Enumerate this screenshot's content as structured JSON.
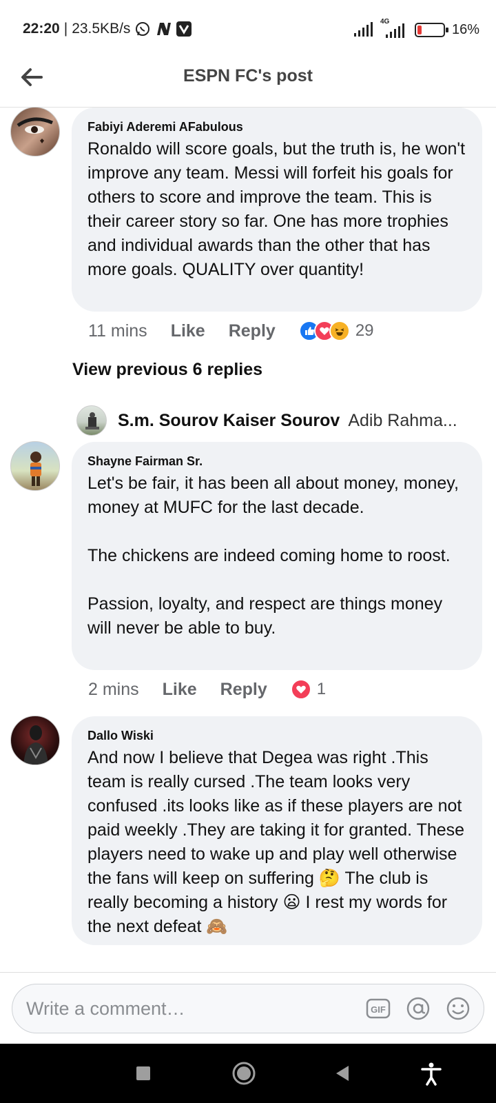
{
  "status_bar": {
    "time": "22:20",
    "speed": "23.5KB/s",
    "network": "4G",
    "battery": "16%",
    "battery_level": 0.16,
    "battery_color": "#e53935"
  },
  "header": {
    "title": "ESPN FC's post",
    "back_icon": "arrow-left-icon"
  },
  "comments": [
    {
      "author": "Fabiyi Aderemi AFabulous",
      "text": "Ronaldo will score goals, but the truth is, he won't improve any team. Messi will forfeit his goals for others to score and improve the team. This is their career story so far. One has more trophies and individual awards than the other that has more goals. QUALITY over quantity!",
      "time": "11 mins",
      "like": "Like",
      "reply": "Reply",
      "reaction_count": "29",
      "reactions": [
        "like",
        "love",
        "haha"
      ]
    },
    {
      "author": "Shayne Fairman Sr.",
      "text": "Let's be fair, it has been all about money, money, money at MUFC for the last decade.\n\nThe chickens are indeed coming home to roost.\n\nPassion, loyalty, and respect are things money will never be able to buy.",
      "time": "2 mins",
      "like": "Like",
      "reply": "Reply",
      "reaction_count": "1",
      "reactions": [
        "love"
      ]
    },
    {
      "author": "Dallo Wiski",
      "text": "And now I believe that Degea was right .This team is really cursed .The team looks very confused .its looks like as if these players are not paid weekly .They are taking it for granted. These players need to wake up and play well otherwise the fans will keep on suffering 🤔 The club is really becoming a history 😦 I rest my words for the next defeat 🙈"
    }
  ],
  "replies_thread": {
    "view_previous": "View previous 6 replies",
    "reply_author": "S.m. Sourov Kaiser Sourov",
    "reply_preview": "Adib Rahma..."
  },
  "composer": {
    "placeholder": "Write a comment…",
    "icons": [
      "gif-icon",
      "mention-icon",
      "emoji-icon"
    ]
  },
  "colors": {
    "like_blue": "#1877f2",
    "love_red": "#f33e58",
    "haha_yellow": "#f7b125",
    "bubble_bg": "#f0f2f5"
  }
}
